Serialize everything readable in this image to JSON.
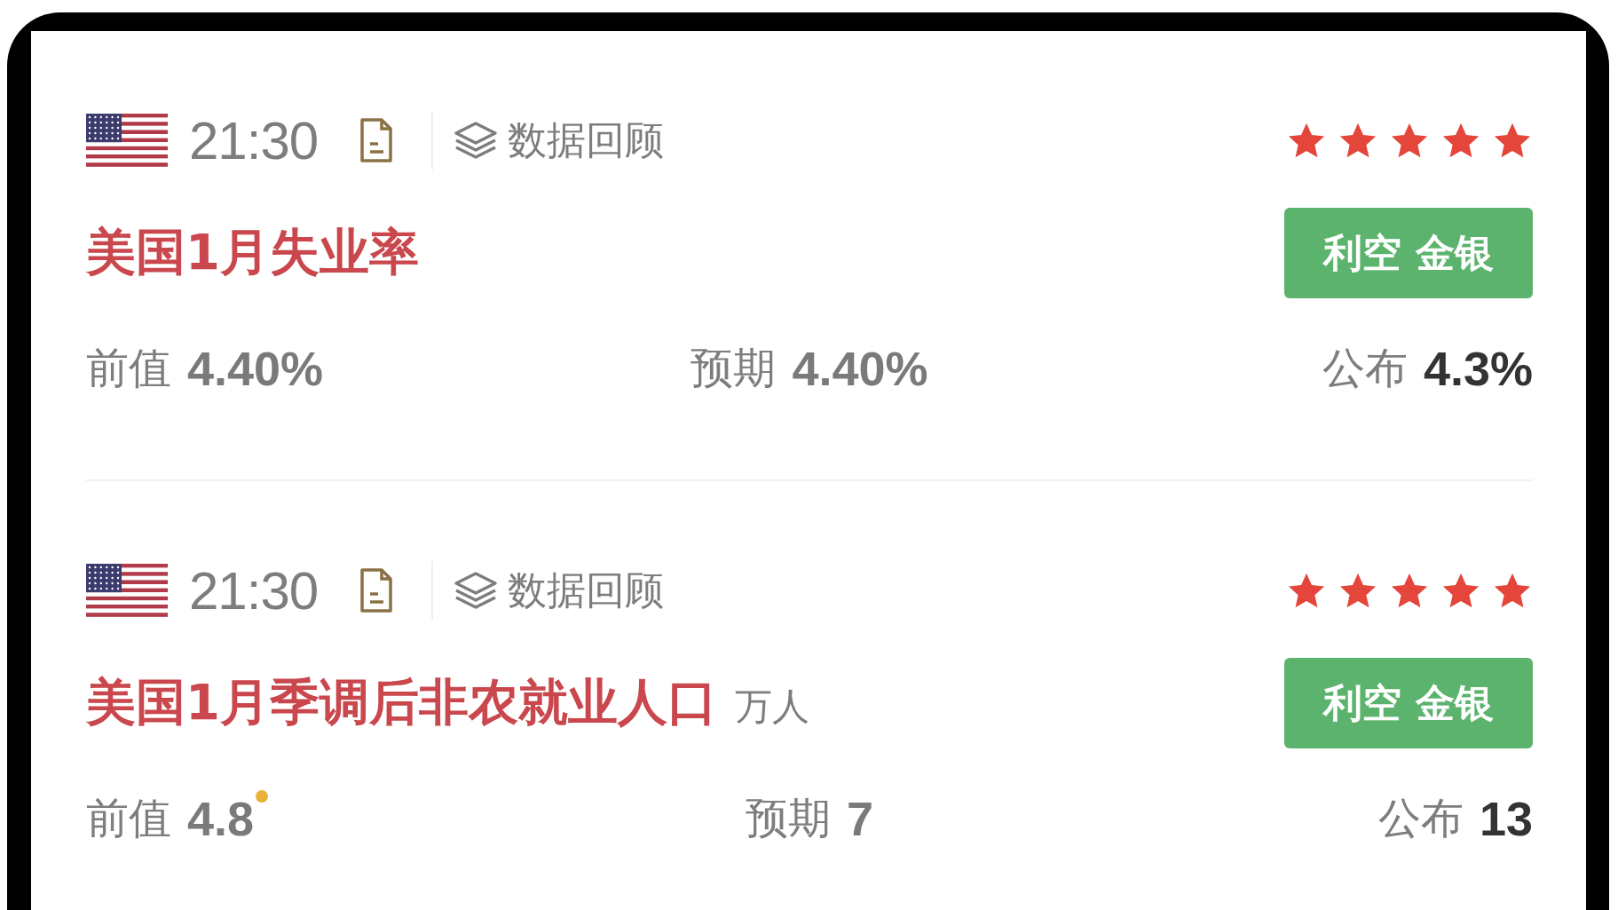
{
  "events": [
    {
      "time": "21:30",
      "review_label": "数据回顾",
      "stars": 5,
      "title": "美国1月失业率",
      "impact": "利空 金银",
      "previous": {
        "label": "前值",
        "value": "4.40%",
        "revised": false
      },
      "forecast": {
        "label": "预期",
        "value": "4.40%"
      },
      "actual": {
        "label": "公布",
        "value": "4.3%"
      }
    },
    {
      "time": "21:30",
      "review_label": "数据回顾",
      "stars": 5,
      "title": "美国1月季调后非农就业人口",
      "unit": "万人",
      "impact": "利空 金银",
      "previous": {
        "label": "前值",
        "value": "4.8",
        "revised": true
      },
      "forecast": {
        "label": "预期",
        "value": "7"
      },
      "actual": {
        "label": "公布",
        "value": "13"
      }
    }
  ]
}
